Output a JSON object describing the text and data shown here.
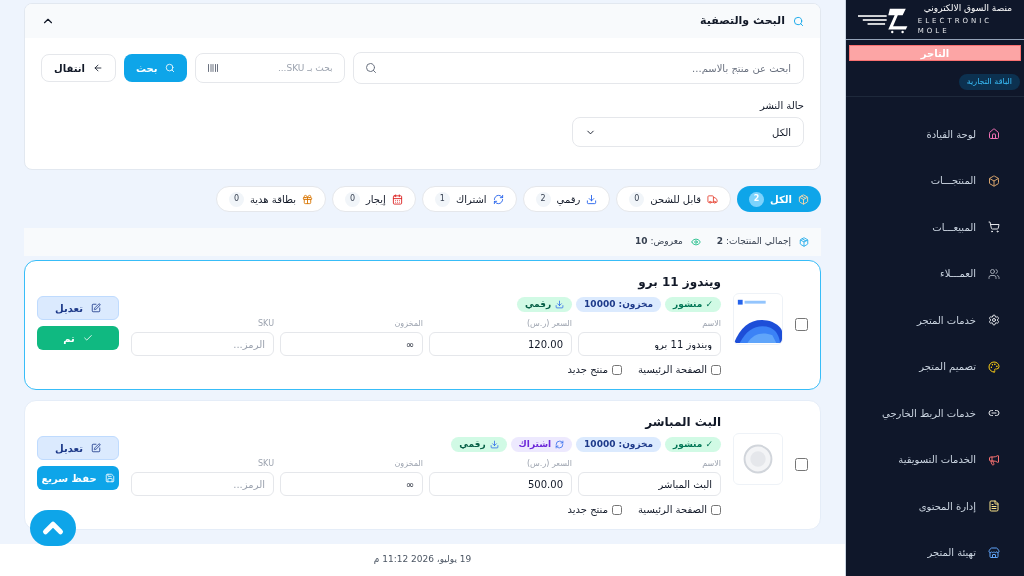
{
  "filter_panel": {
    "title": "البحث والتصفية",
    "expanded": true,
    "name_search": {
      "placeholder": "ابحث عن منتج بالاسم..."
    },
    "sku_search": {
      "placeholder": "بحث بـ SKU..."
    },
    "search_button": "بحث",
    "go_button": "انتقال",
    "status_label": "حالة النشر",
    "status_value": "الكل"
  },
  "tabs": [
    {
      "label": "الكل",
      "count": "2",
      "selected": true
    },
    {
      "label": "قابل للشحن",
      "count": "0",
      "selected": false
    },
    {
      "label": "رقمي",
      "count": "2",
      "selected": false
    },
    {
      "label": "اشتراك",
      "count": "1",
      "selected": false
    },
    {
      "label": "إيجار",
      "count": "0",
      "selected": false
    },
    {
      "label": "بطاقة هدية",
      "count": "0",
      "selected": false
    }
  ],
  "stats": {
    "total": "إجمالي المنتجات: **2**",
    "shown": "معروض: **10**"
  },
  "products": [
    {
      "name": "ويندوز 11 برو",
      "checked": false,
      "highlighted": true,
      "badges": [
        {
          "kind": "published",
          "text": "✓ منشور"
        },
        {
          "kind": "stock",
          "text": "مخزون: 10000"
        },
        {
          "kind": "digital",
          "text": "رقمي"
        }
      ],
      "fields": [
        {
          "label": "الاسم",
          "value": "ويندوز 11 برو"
        },
        {
          "label": "السعر (ر.س)",
          "value": "120.00"
        },
        {
          "label": "المخزون",
          "value": "∞"
        },
        {
          "label": "SKU",
          "placeholder": "الرمز..."
        }
      ],
      "options": [
        {
          "label": "الصفحة الرئيسية",
          "checked": false
        },
        {
          "label": "منتج جديد",
          "checked": false
        }
      ],
      "buttons": [
        {
          "kind": "edit",
          "label": "تعديل"
        },
        {
          "kind": "done",
          "label": "تم"
        }
      ]
    },
    {
      "name": "البث المباشر",
      "checked": false,
      "highlighted": false,
      "badges": [
        {
          "kind": "published",
          "text": "✓ منشور"
        },
        {
          "kind": "stock",
          "text": "مخزون: 10000"
        },
        {
          "kind": "subscription",
          "text": "اشتراك"
        },
        {
          "kind": "digital",
          "text": "رقمي"
        }
      ],
      "fields": [
        {
          "label": "الاسم",
          "value": "البث المباشر"
        },
        {
          "label": "السعر (ر.س)",
          "value": "500.00"
        },
        {
          "label": "المخزون",
          "value": "∞"
        },
        {
          "label": "SKU",
          "placeholder": "الرمز..."
        }
      ],
      "options": [
        {
          "label": "الصفحة الرئيسية",
          "checked": false
        },
        {
          "label": "منتج جديد",
          "checked": false
        }
      ],
      "buttons": [
        {
          "kind": "edit",
          "label": "تعديل"
        },
        {
          "kind": "save",
          "label": "حفظ سريع"
        }
      ]
    }
  ],
  "footer": "19 يوليو، 2026 11:12 م",
  "sidebar": {
    "logo_title": "منصة السوق الالكتروني",
    "logo_subtitle": "ELECTRONIC MOLE",
    "role": "التاجر",
    "plan": "الباقة التجارية",
    "items": [
      {
        "label": "لوحة القيادة"
      },
      {
        "label": "المنتجـــات"
      },
      {
        "label": "المبيعـــات"
      },
      {
        "label": "العمـــلاء"
      },
      {
        "label": "خدمات المتجر"
      },
      {
        "label": "تصميم المتجر"
      },
      {
        "label": "خدمات الربط الخارجي"
      },
      {
        "label": "الخدمات التسويقية"
      },
      {
        "label": "إدارة المحتوى"
      },
      {
        "label": "تهيئة المتجر"
      }
    ]
  }
}
